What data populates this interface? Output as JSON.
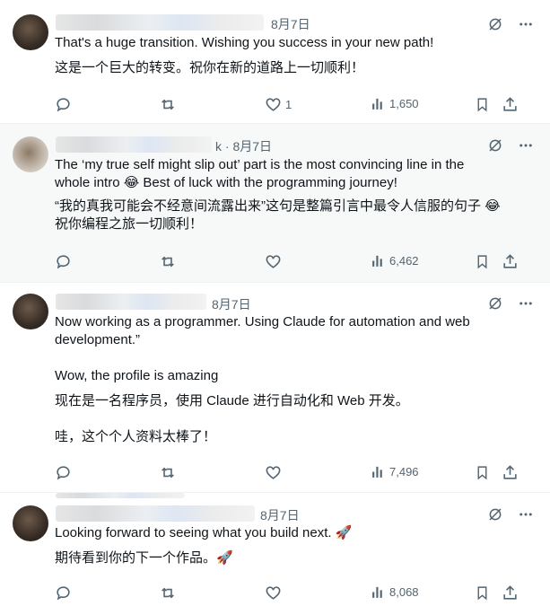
{
  "tweets": [
    {
      "date": "8月7日",
      "lines": [
        "That's a huge transition. Wishing you success in your new path!",
        "这是一个巨大的转变。祝你在新的道路上一切顺利！"
      ],
      "likes": "1",
      "views": "1,650"
    },
    {
      "date": "k · 8月7日",
      "lines": [
        "The ‘my true self might slip out’ part is the most convincing line in the",
        "whole intro 😂 Best of luck with the programming journey!",
        "“我的真我可能会不经意间流露出来”这句是整篇引言中最令人信服的句子 😂",
        "祝你编程之旅一切顺利！"
      ],
      "likes": "",
      "views": "6,462"
    },
    {
      "date": "8月7日",
      "lines": [
        "Now working as a programmer. Using Claude for automation and web",
        "development.”",
        "Wow, the profile is amazing",
        "现在是一名程序员，使用 Claude 进行自动化和 Web 开发。",
        "哇，这个个人资料太棒了！"
      ],
      "likes": "",
      "views": "7,496"
    },
    {
      "date": "8月7日",
      "lines": [
        "Looking forward to seeing what you build next. 🚀",
        "期待看到你的下一个作品。🚀"
      ],
      "likes": "",
      "views": "8,068"
    }
  ],
  "icons": {
    "grok": "grok-icon",
    "more": "more-icon",
    "reply": "reply-icon",
    "repost": "repost-icon",
    "like": "heart-icon",
    "views": "views-icon",
    "bookmark": "bookmark-icon",
    "share": "share-icon"
  },
  "colors": {
    "text": "#0f1419",
    "muted": "#536471",
    "highlight_bg": "#f7f9f9",
    "divider": "#eff3f4"
  }
}
